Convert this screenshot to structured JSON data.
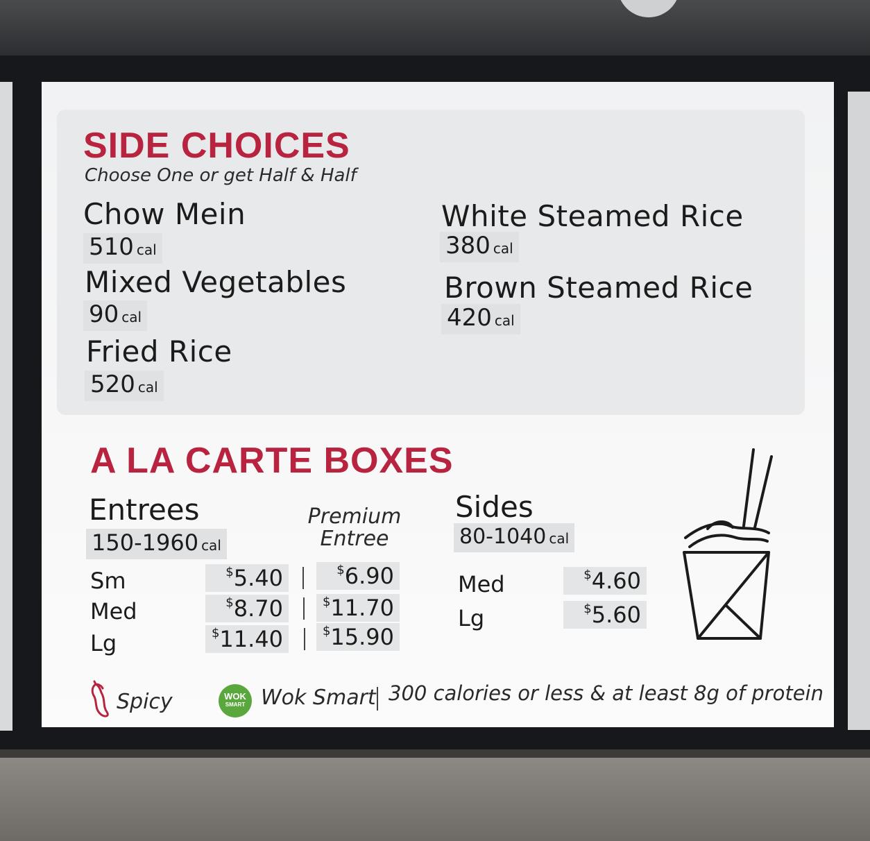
{
  "side_choices": {
    "title": "SIDE CHOICES",
    "subtitle": "Choose One or get Half & Half",
    "cal_unit": "cal",
    "items": [
      {
        "name": "Chow Mein",
        "calories": "510"
      },
      {
        "name": "Mixed Vegetables",
        "calories": "90"
      },
      {
        "name": "Fried Rice",
        "calories": "520"
      },
      {
        "name": "White Steamed Rice",
        "calories": "380"
      },
      {
        "name": "Brown Steamed Rice",
        "calories": "420"
      }
    ]
  },
  "a_la_carte": {
    "title": "A LA CARTE BOXES",
    "entrees": {
      "heading": "Entrees",
      "calories": "150-1960",
      "premium_label_line1": "Premium",
      "premium_label_line2": "Entree",
      "sizes": [
        {
          "size": "Sm",
          "price": "5.40",
          "premium_price": "6.90"
        },
        {
          "size": "Med",
          "price": "8.70",
          "premium_price": "11.70"
        },
        {
          "size": "Lg",
          "price": "11.40",
          "premium_price": "15.90"
        }
      ]
    },
    "sides": {
      "heading": "Sides",
      "calories": "80-1040",
      "sizes": [
        {
          "size": "Med",
          "price": "4.60"
        },
        {
          "size": "Lg",
          "price": "5.60"
        }
      ]
    },
    "currency_symbol": "$"
  },
  "legend": {
    "spicy_label": "Spicy",
    "wok_badge_line1": "WOK",
    "wok_badge_line2": "SMART",
    "wok_smart_label": "Wok Smart",
    "wok_smart_desc": "300 calories or less & at least 8g of protein"
  },
  "colors": {
    "accent_red": "#b8233f",
    "wok_smart_green": "#5aa83d"
  },
  "icons": [
    "chili-pepper-icon",
    "noodle-box-icon",
    "wok-smart-badge-icon"
  ]
}
